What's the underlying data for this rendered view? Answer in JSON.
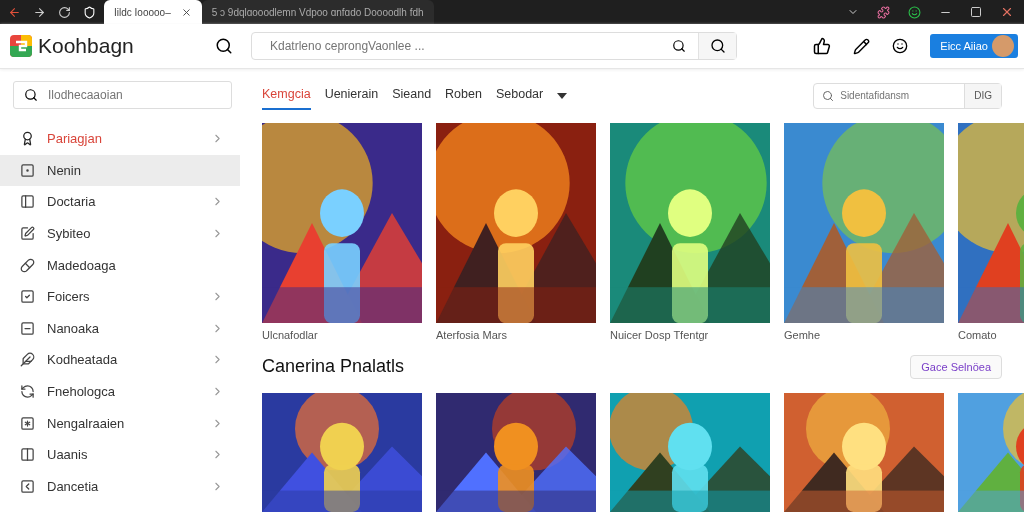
{
  "browser": {
    "tabs": [
      {
        "label": "Iildc Iooooo–",
        "selected": true
      },
      {
        "label": "5 ɔ 9dqlɑooodlemn    Vdpoo ɑnfɑdo Doooodlh fdh",
        "selected": false
      }
    ]
  },
  "header": {
    "logo": "Koohbagn",
    "search": {
      "placeholder": "Kdatrleno ceprongVaonlee ..."
    },
    "button": "Eicc Aiiao"
  },
  "sidebar": {
    "search": {
      "placeholder": "Ilodhecaaoian"
    },
    "items": [
      {
        "label": "Pariagjan",
        "selected": false,
        "accent": true,
        "chevron": true
      },
      {
        "label": "Nenin",
        "selected": true,
        "accent": false,
        "chevron": false
      },
      {
        "label": "Doctaria",
        "selected": false,
        "accent": false,
        "chevron": true
      },
      {
        "label": "Sybiteo",
        "selected": false,
        "accent": false,
        "chevron": true
      },
      {
        "label": "Madedoaga",
        "selected": false,
        "accent": false,
        "chevron": false
      },
      {
        "label": "Foicers",
        "selected": false,
        "accent": false,
        "chevron": true
      },
      {
        "label": "Nanoaka",
        "selected": false,
        "accent": false,
        "chevron": true
      },
      {
        "label": "Kodheatada",
        "selected": false,
        "accent": false,
        "chevron": true
      },
      {
        "label": "Fnehologca",
        "selected": false,
        "accent": false,
        "chevron": true
      },
      {
        "label": "Nengalraaien",
        "selected": false,
        "accent": false,
        "chevron": true
      },
      {
        "label": "Uaanis",
        "selected": false,
        "accent": false,
        "chevron": true
      },
      {
        "label": "Dancetia",
        "selected": false,
        "accent": false,
        "chevron": true
      }
    ]
  },
  "tabs": [
    {
      "label": "Kemgcia",
      "selected": true
    },
    {
      "label": "Uenierain",
      "selected": false
    },
    {
      "label": "Sieand",
      "selected": false
    },
    {
      "label": "Roben",
      "selected": false
    },
    {
      "label": "Sebodar",
      "selected": false
    }
  ],
  "filter": {
    "placeholder": "Sidentafidansm",
    "button": "DIG"
  },
  "featured": [
    {
      "caption": "Ulcnafodlar"
    },
    {
      "caption": "Aterfosia Mars"
    },
    {
      "caption": "Nuicer Dosp Tfentgr"
    },
    {
      "caption": "Gemhe"
    },
    {
      "caption": "Comato"
    }
  ],
  "section": {
    "title": "Canerina Pnalatls",
    "button": "Gace Selnöea"
  }
}
